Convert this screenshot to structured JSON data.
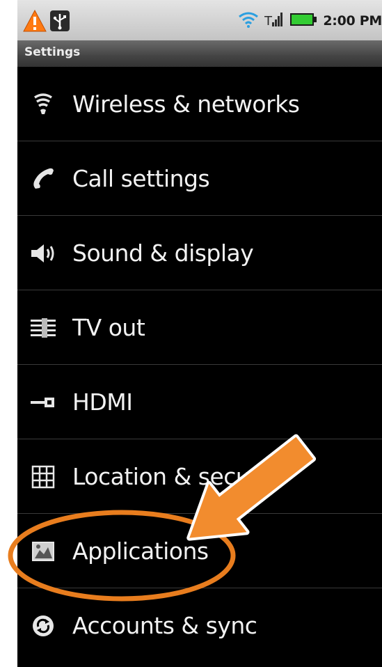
{
  "status_bar": {
    "time": "2:00 PM",
    "left_icons": [
      "warning-icon",
      "usb-icon"
    ],
    "right_icons": [
      "wifi-icon",
      "signal-icon",
      "battery-icon"
    ],
    "battery_color": "#33cc33",
    "wifi_color": "#2a9fe0"
  },
  "title_bar": {
    "title": "Settings"
  },
  "menu": {
    "items": [
      {
        "label": "Wireless & networks",
        "icon": "wireless-icon"
      },
      {
        "label": "Call settings",
        "icon": "phone-icon"
      },
      {
        "label": "Sound & display",
        "icon": "speaker-icon"
      },
      {
        "label": "TV out",
        "icon": "tv-out-icon"
      },
      {
        "label": "HDMI",
        "icon": "hdmi-icon"
      },
      {
        "label": "Location & secu",
        "icon": "location-grid-icon"
      },
      {
        "label": "Applications",
        "icon": "applications-icon"
      },
      {
        "label": "Accounts & sync",
        "icon": "sync-icon"
      }
    ]
  },
  "annotation": {
    "highlight_target": "Applications",
    "color": "#e87d1e"
  }
}
